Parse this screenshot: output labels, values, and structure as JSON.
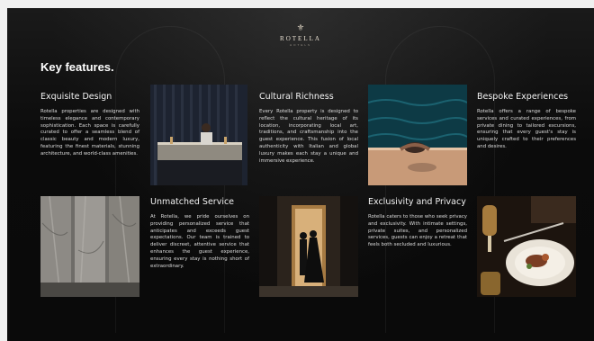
{
  "brand": {
    "name": "ROTELLA",
    "sub": "HOTELS"
  },
  "section_title": "Key features.",
  "features": [
    {
      "title": "Exquisite Design",
      "body": "Rotella properties are designed with timeless elegance and contemporary sophistication. Each space is carefully curated to offer a seamless blend of classic beauty and modern luxury, featuring the finest materials, stunning architecture, and world-class amenities."
    },
    {
      "title": "Cultural Richness",
      "body": "Every Rotella property is designed to reflect the cultural heritage of its location, incorporating local art, traditions, and craftsmanship into the guest experience. This fusion of local authenticity with Italian and global luxury makes each stay a unique and immersive experience."
    },
    {
      "title": "Bespoke Experiences",
      "body": "Rotella offers a range of bespoke services and curated experiences, from private dining to tailored excursions, ensuring that every guest's stay is uniquely crafted to their preferences and desires."
    },
    {
      "title": "Unmatched Service",
      "body": "At Rotella, we pride ourselves on providing personalized service that anticipates and exceeds guest expectations. Our team is trained to deliver discreet, attentive service that enhances the guest experience, ensuring every stay is nothing short of extraordinary."
    },
    {
      "title": "Exclusivity and Privacy",
      "body": "Rotella caters to those who seek privacy and exclusivity. With intimate settings, private suites, and personalized services, guests can enjoy a retreat that feels both secluded and luxurious."
    }
  ]
}
